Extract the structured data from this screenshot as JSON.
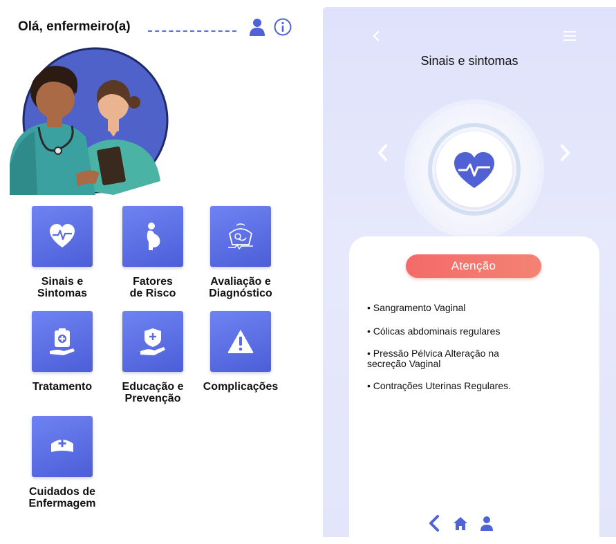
{
  "left": {
    "greeting": "Olá, enfermeiro(a)",
    "tiles": [
      {
        "label": "Sinais e\nSintomas",
        "icon": "heart-pulse-icon"
      },
      {
        "label": "Fatores\nde Risco",
        "icon": "pregnant-woman-icon"
      },
      {
        "label": "Avaliação e\nDiagnóstico",
        "icon": "ultrasound-baby-icon"
      },
      {
        "label": "Tratamento",
        "icon": "medical-kit-hand-icon"
      },
      {
        "label": "Educação e\nPrevenção",
        "icon": "shield-hand-icon"
      },
      {
        "label": "Complicações",
        "icon": "warning-triangle-icon"
      },
      {
        "label": "Cuidados de\nEnfermagem",
        "icon": "nurse-cap-icon"
      }
    ]
  },
  "right": {
    "title": "Sinais e sintomas",
    "attention_label": "Atenção",
    "symptoms": [
      "• Sangramento Vaginal",
      "• Cólicas abdominais regulares",
      "• Pressão Pélvica Alteração na secreção Vaginal",
      "• Contrações Uterinas Regulares."
    ]
  },
  "colors": {
    "tile_gradient_start": "#6e83f2",
    "tile_gradient_end": "#4c5ed8",
    "accent": "#5a6bdc",
    "attention": "#f46a6a",
    "right_background": "#e1e4fb"
  }
}
